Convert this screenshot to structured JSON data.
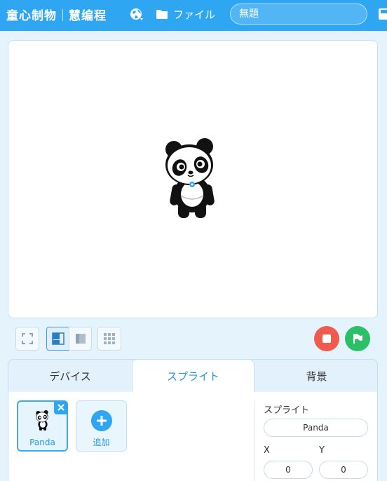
{
  "topbar": {
    "brand_part1": "童心制物",
    "brand_part2": "慧编程",
    "file_label": "ファイル",
    "project_title": "無題",
    "bg_color": "#2ea6f2"
  },
  "stage": {
    "sprite_name": "Panda"
  },
  "controls": {
    "stop_color": "#f15a4f",
    "go_color": "#2bbf67"
  },
  "panel": {
    "tabs": [
      {
        "label": "デバイス",
        "active": false
      },
      {
        "label": "スプライト",
        "active": true
      },
      {
        "label": "背景",
        "active": false
      }
    ],
    "sprites": [
      {
        "label": "Panda",
        "selected": true
      }
    ],
    "add_label": "追加",
    "properties": {
      "sprite_heading": "スプライト",
      "sprite_name": "Panda",
      "x_label": "X",
      "y_label": "Y",
      "x_value": "0",
      "y_value": "0"
    }
  }
}
